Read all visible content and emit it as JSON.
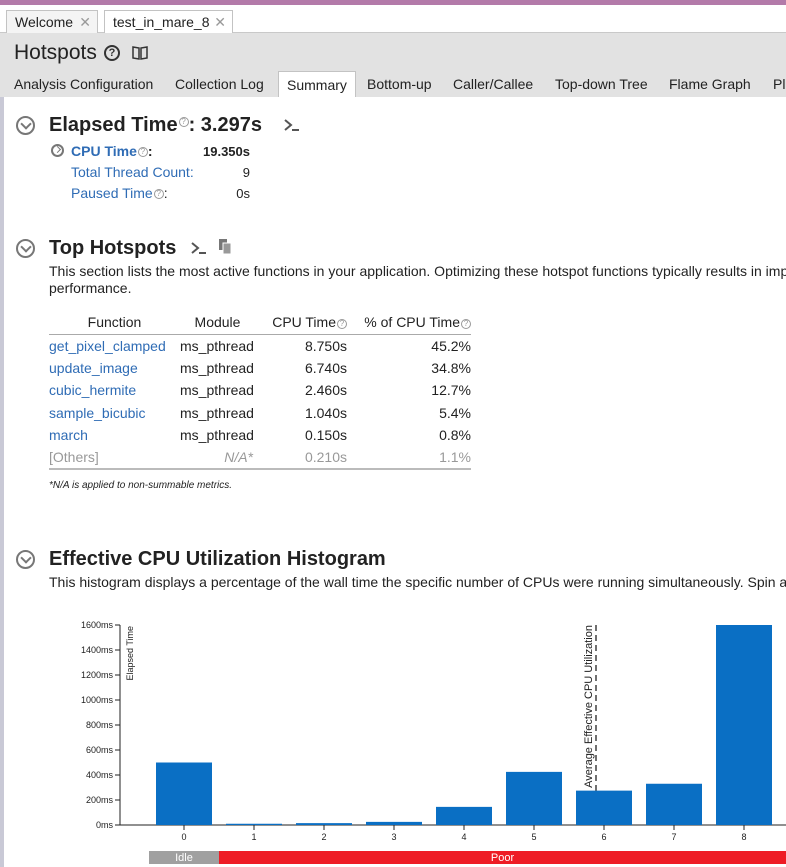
{
  "tabs": [
    {
      "label": "Welcome",
      "active": false
    },
    {
      "label": "test_in_mare_8",
      "active": true
    }
  ],
  "header": {
    "title": "Hotspots",
    "subtabs": [
      "Analysis Configuration",
      "Collection Log",
      "Summary",
      "Bottom-up",
      "Caller/Callee",
      "Top-down Tree",
      "Flame Graph",
      "Pl"
    ],
    "active_subtab": "Summary"
  },
  "elapsed": {
    "title": "Elapsed Time",
    "value": ": 3.297s",
    "cpu_time_label": "CPU Time",
    "cpu_time_colon": ":",
    "cpu_time_value": "19.350s",
    "thread_count_label": "Total Thread Count:",
    "thread_count_value": "9",
    "paused_label": "Paused Time",
    "paused_colon": ":",
    "paused_value": "0s"
  },
  "hotspots": {
    "title": "Top Hotspots",
    "description_line1": "This section lists the most active functions in your application. Optimizing these hotspot functions typically results in imp",
    "description_line2": "performance.",
    "columns": {
      "function": "Function",
      "module": "Module",
      "cpu_time": "CPU Time",
      "pct": "% of CPU Time"
    },
    "rows": [
      {
        "function": "get_pixel_clamped",
        "module": "ms_pthread",
        "cpu_time": "8.750s",
        "pct": "45.2%"
      },
      {
        "function": "update_image",
        "module": "ms_pthread",
        "cpu_time": "6.740s",
        "pct": "34.8%"
      },
      {
        "function": "cubic_hermite",
        "module": "ms_pthread",
        "cpu_time": "2.460s",
        "pct": "12.7%"
      },
      {
        "function": "sample_bicubic",
        "module": "ms_pthread",
        "cpu_time": "1.040s",
        "pct": "5.4%"
      },
      {
        "function": "march",
        "module": "ms_pthread",
        "cpu_time": "0.150s",
        "pct": "0.8%"
      },
      {
        "function": "[Others]",
        "module": "N/A*",
        "cpu_time": "0.210s",
        "pct": "1.1%"
      }
    ],
    "note": "*N/A is applied to non-summable metrics."
  },
  "histogram": {
    "title": "Effective CPU Utilization Histogram",
    "description": "This histogram displays a percentage of the wall time the specific number of CPUs were running simultaneously. Spin a"
  },
  "chart_data": {
    "type": "bar",
    "categories": [
      "0",
      "1",
      "2",
      "3",
      "4",
      "5",
      "6",
      "7",
      "8"
    ],
    "values": [
      500,
      10,
      15,
      25,
      145,
      425,
      275,
      330,
      1600
    ],
    "ylabel": "Elapsed Time",
    "yticks": [
      "0ms",
      "200ms",
      "400ms",
      "600ms",
      "800ms",
      "1000ms",
      "1200ms",
      "1400ms",
      "1600ms"
    ],
    "ylim": [
      0,
      1600
    ],
    "average_marker_label": "Average Effective CPU Utilization",
    "average_marker_x": 6,
    "bar_color": "#0a6fc4",
    "ranges": [
      {
        "label": "Idle",
        "from": 0,
        "to": 0.5,
        "color": "#a0a0a0"
      },
      {
        "label": "Poor",
        "from": 0.5,
        "to": 8.5,
        "color": "#ee1c25"
      }
    ]
  }
}
